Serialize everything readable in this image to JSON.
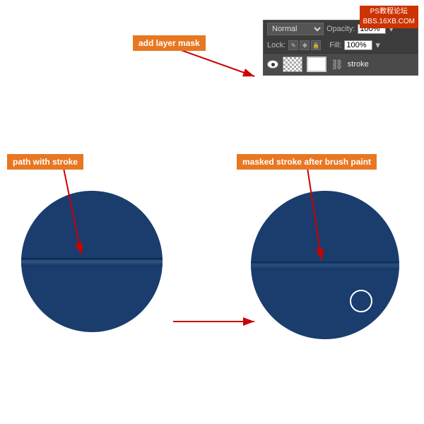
{
  "watermark": {
    "line1": "PS教程论坛",
    "line2": "BBS.16XB.COM"
  },
  "panel": {
    "blend_mode": "Normal",
    "opacity_label": "Opacity:",
    "opacity_value": "100%",
    "lock_label": "Lock:",
    "fill_label": "Fill:",
    "fill_value": "100%",
    "layer_name": "stroke"
  },
  "annotations": {
    "add_layer_mask": "add layer mask",
    "path_with_stroke": "path with stroke",
    "masked_stroke": "masked stroke after brush paint"
  },
  "arrow_color": "#cc0000"
}
